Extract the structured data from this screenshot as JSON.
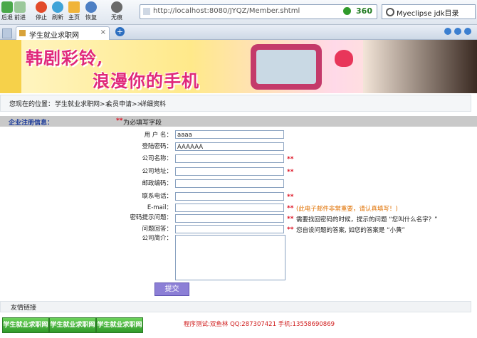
{
  "browser": {
    "nav_buttons": [
      {
        "label": "后退",
        "icon": "back-arrow-icon"
      },
      {
        "label": "前进",
        "icon": "forward-arrow-icon"
      },
      {
        "label": "停止",
        "icon": "stop-icon"
      },
      {
        "label": "刷新",
        "icon": "refresh-icon"
      },
      {
        "label": "主页",
        "icon": "home-icon"
      },
      {
        "label": "恢复",
        "icon": "restore-icon"
      },
      {
        "label": "无痕",
        "icon": "incognito-icon"
      }
    ],
    "url": "http://localhost:8080/JYQZ/Member.shtml",
    "brand": "360",
    "search_value": "Myeclipse jdk目录",
    "tab_title": "学生就业求职网"
  },
  "banner": {
    "line1": "韩剧彩铃,",
    "line2": "浪漫你的手机"
  },
  "breadcrumb": {
    "prefix": "您现在的位置：",
    "items": [
      "学生就业求职网>>",
      "会员申请>>",
      "详细资料"
    ]
  },
  "section": {
    "title": "企业注册信息：",
    "required_mark": "**",
    "required_note": "为必填写字段"
  },
  "form": {
    "fields": [
      {
        "label": "用 户 名：",
        "value": "aaaa",
        "required": false,
        "hint": ""
      },
      {
        "label": "登陆密码：",
        "value": "AAAAAA",
        "required": false,
        "hint": ""
      },
      {
        "label": "公司名称：",
        "value": "",
        "required": true,
        "hint": ""
      },
      {
        "label": "公司地址：",
        "value": "",
        "required": true,
        "hint": ""
      },
      {
        "label": "邮政编码：",
        "value": "",
        "required": false,
        "hint": ""
      },
      {
        "label": "联系电话：",
        "value": "",
        "required": true,
        "hint": ""
      },
      {
        "label": "E-mail：",
        "value": "",
        "required": true,
        "hint": "(此电子邮件非常重要，请认真填写！)"
      },
      {
        "label": "密码提示问题：",
        "value": "",
        "required": true,
        "hint": "需要找回密码的时候，提示的问题 “您叫什么名字？”"
      },
      {
        "label": "问题回答：",
        "value": "",
        "required": true,
        "hint": "您自设问题的答案, 如您的答案是 “小黄”"
      }
    ],
    "intro_label": "公司简介：",
    "submit_label": "提交"
  },
  "footer": {
    "links_title": "友情链接",
    "link_buttons": [
      "学生就业求职网",
      "学生就业求职网",
      "学生就业求职网"
    ],
    "contact": "程序测试:双鱼林 QQ:287307421 手机:13558690869"
  },
  "colors": {
    "required": "#dd1122",
    "email_hint": "#e07000",
    "section_title": "#1c3b9a",
    "submit_bg": "#8c7fd6",
    "contact": "#d01c1c"
  }
}
